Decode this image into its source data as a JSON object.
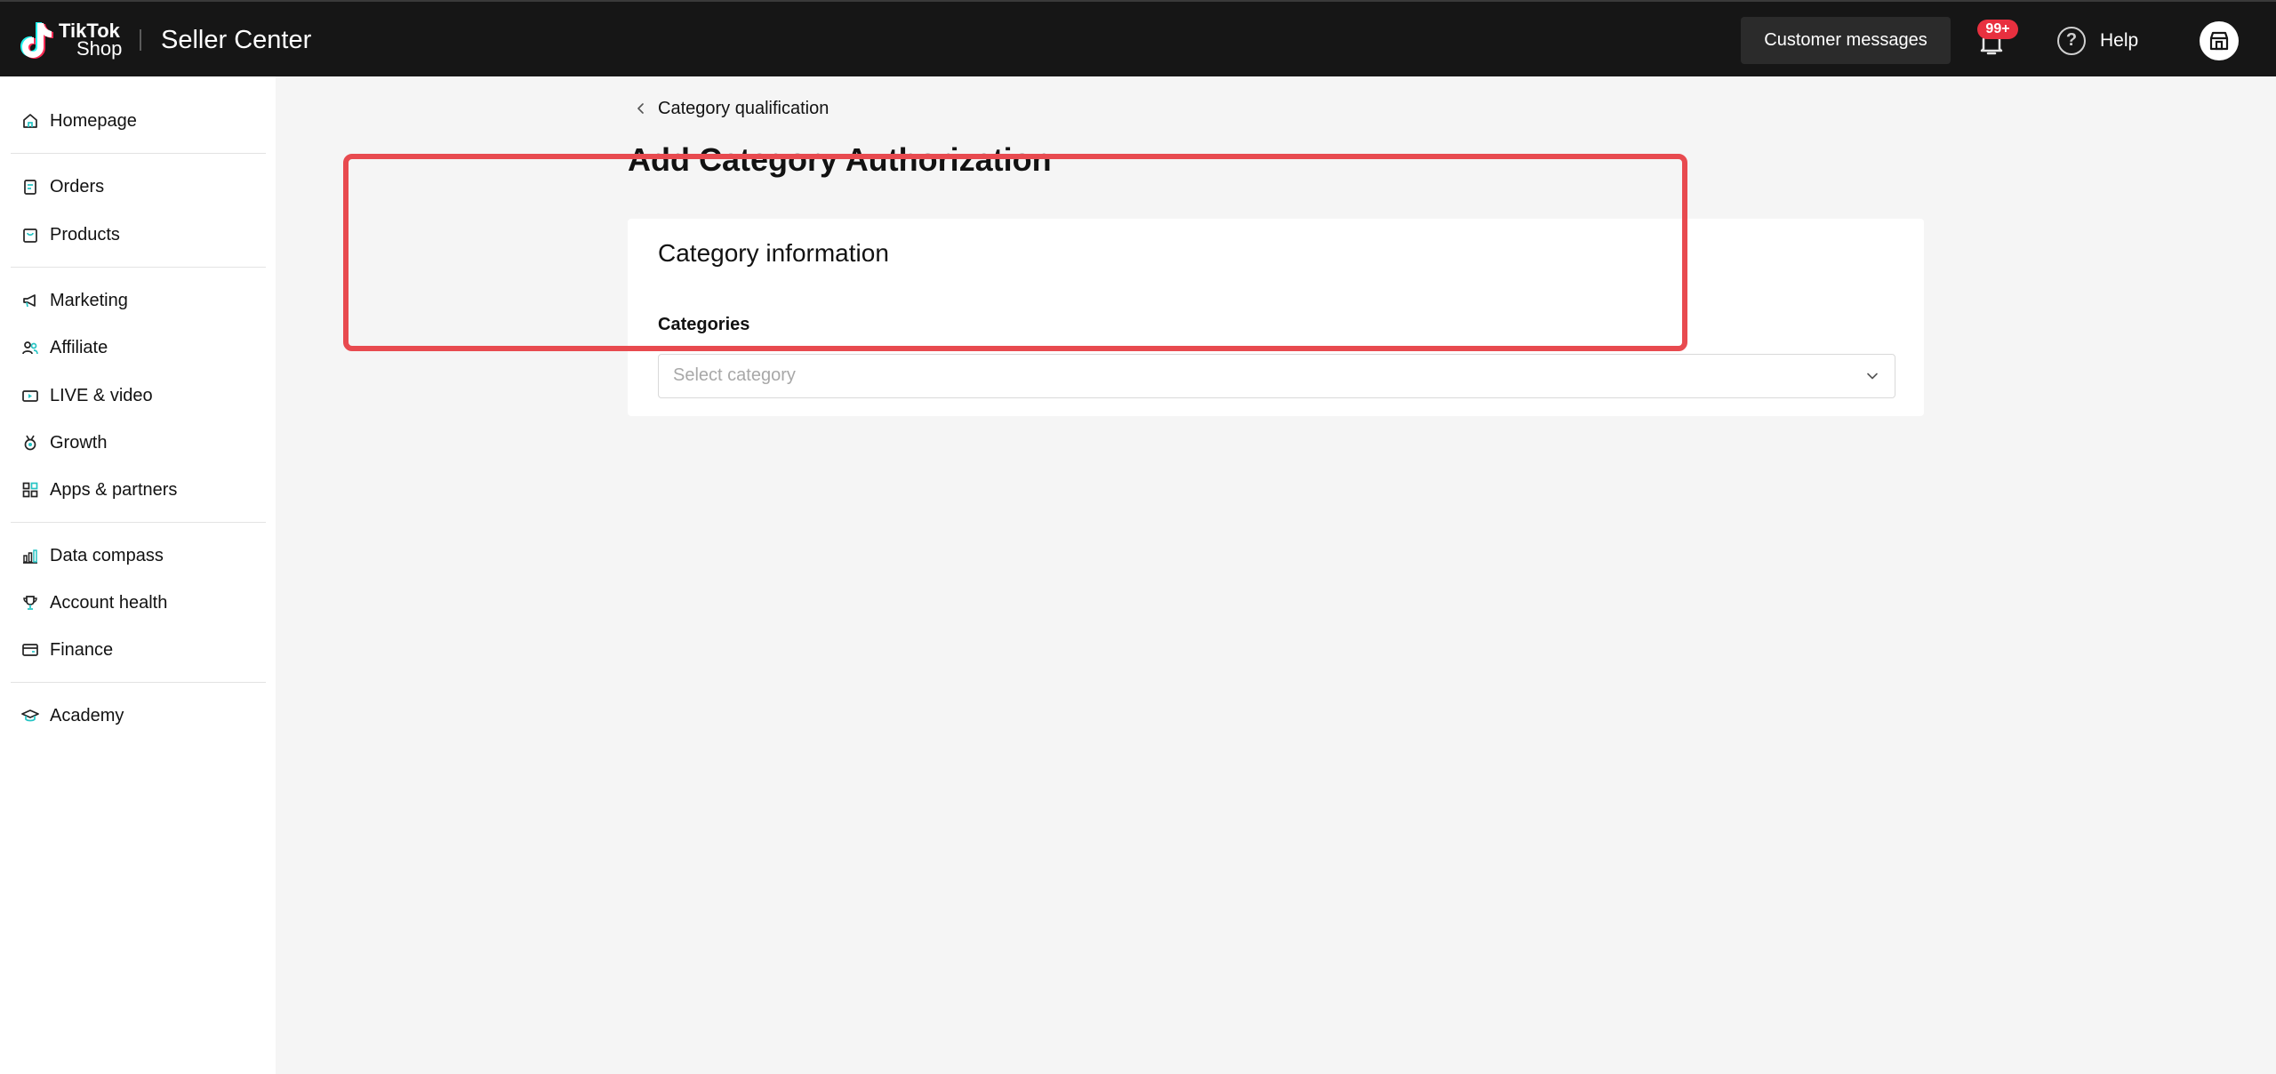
{
  "header": {
    "brand_line1": "TikTok",
    "brand_line2": "Shop",
    "title": "Seller Center",
    "customer_messages": "Customer messages",
    "notification_badge": "99+",
    "help_label": "Help",
    "icons": {
      "logo": "tiktok-logo-icon",
      "bell": "bell-icon",
      "help": "help-circle-icon",
      "store": "store-icon"
    }
  },
  "sidebar": {
    "items": [
      {
        "label": "Homepage",
        "icon": "home-icon"
      },
      {
        "label": "Orders",
        "icon": "clipboard-icon"
      },
      {
        "label": "Products",
        "icon": "bag-icon"
      },
      {
        "label": "Marketing",
        "icon": "megaphone-icon"
      },
      {
        "label": "Affiliate",
        "icon": "people-icon"
      },
      {
        "label": "LIVE & video",
        "icon": "video-icon"
      },
      {
        "label": "Growth",
        "icon": "medal-icon"
      },
      {
        "label": "Apps & partners",
        "icon": "apps-grid-icon"
      },
      {
        "label": "Data compass",
        "icon": "bar-chart-icon"
      },
      {
        "label": "Account health",
        "icon": "trophy-icon"
      },
      {
        "label": "Finance",
        "icon": "wallet-icon"
      },
      {
        "label": "Academy",
        "icon": "graduation-cap-icon"
      }
    ]
  },
  "main": {
    "breadcrumb": "Category qualification",
    "page_title": "Add Category Authorization",
    "card": {
      "title": "Category information",
      "field_label": "Categories",
      "select_placeholder": "Select category"
    }
  },
  "colors": {
    "topbar": "#161616",
    "accent_teal": "#25c4c4",
    "badge_red": "#e8303f",
    "highlight_red": "#e84a4f"
  }
}
